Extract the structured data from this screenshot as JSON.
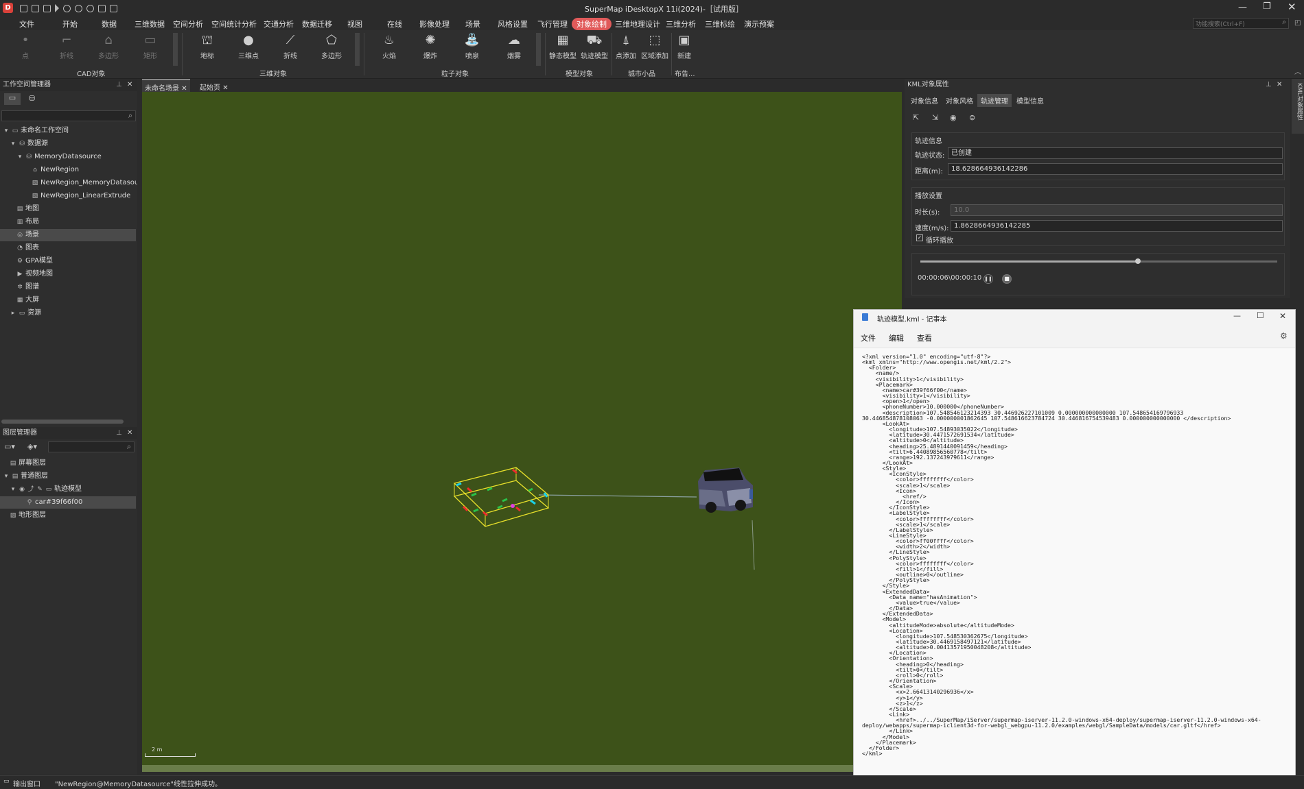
{
  "app": {
    "title": "SuperMap iDesktopX 11i(2024)-［试用版］",
    "search_placeholder": "功能搜索(Ctrl+F)"
  },
  "menu": [
    "文件",
    "开始",
    "数据",
    "三维数据",
    "空间分析",
    "空间统计分析",
    "交通分析",
    "数据迁移",
    "视图",
    "在线",
    "影像处理",
    "场景",
    "风格设置",
    "飞行管理",
    "对象绘制",
    "三维地理设计",
    "三维分析",
    "三维标绘",
    "演示预案"
  ],
  "ribbon": {
    "cad": [
      "点",
      "折线",
      "多边形",
      "矩形"
    ],
    "cad_group": "CAD对象",
    "obj3d": [
      "地标",
      "三维点",
      "折线",
      "多边形"
    ],
    "obj3d_group": "三维对象",
    "particle": [
      "火焰",
      "爆炸",
      "喷泉",
      "烟雾"
    ],
    "particle_group": "粒子对象",
    "model": [
      "静态模型",
      "轨迹模型"
    ],
    "model_group": "模型对象",
    "city": [
      "点添加",
      "区域添加"
    ],
    "city_group": "城市小品",
    "layout": [
      "新建"
    ],
    "layout_group": "布告..."
  },
  "workspace": {
    "title": "工作空间管理器",
    "items": [
      "未命名工作空间",
      "数据源",
      "MemoryDatasource",
      "NewRegion",
      "NewRegion_MemoryDatasource",
      "NewRegion_LinearExtrude",
      "地图",
      "布局",
      "场景",
      "图表",
      "GPA模型",
      "视频地图",
      "图谱",
      "大屏",
      "资源"
    ]
  },
  "layers": {
    "title": "图层管理器",
    "items": [
      "屏幕图层",
      "普通图层",
      "轨迹模型",
      "car#39f66f00",
      "地形图层"
    ]
  },
  "tabs": [
    "未命名场景",
    "起始页"
  ],
  "scale_label": "2 m",
  "kml": {
    "title": "KML对象属性",
    "side_tab": "KML对象属性",
    "tabs": [
      "对象信息",
      "对象风格",
      "轨迹管理",
      "模型信息"
    ],
    "track_info": "轨迹信息",
    "status_label": "轨迹状态:",
    "status_value": "已创建",
    "dist_label": "距离(m):",
    "dist_value": "18.628664936142286",
    "play_settings": "播放设置",
    "duration_label": "时长(s):",
    "duration_value": "10.0",
    "speed_label": "速度(m/s):",
    "speed_value": "1.8628664936142285",
    "loop_label": "循环播放",
    "time_text": "00:00:06\\00:00:10",
    "progress": 0.61
  },
  "notepad": {
    "title": "轨迹模型.kml - 记事本",
    "menu": [
      "文件",
      "编辑",
      "查看"
    ],
    "content": "<?xml version=\"1.0\" encoding=\"utf-8\"?>\n<kml xmlns=\"http://www.opengis.net/kml/2.2\">\n  <Folder>\n    <name/>\n    <visibility>1</visibility>\n    <Placemark>\n      <name>car#39f66f00</name>\n      <visibility>1</visibility>\n      <open>1</open>\n      <phoneNumber>10.000000</phoneNumber>\n      <description>107.548546123214393 30.446926227101009 0.000000000000000 107.548654169796933\n30.446854878108063 -0.000000001862645 107.548616623784724 30.446816754539483 0.000000000000000 </description>\n      <LookAt>\n        <longitude>107.54893035022</longitude>\n        <latitude>30.4471572691534</latitude>\n        <altitude>0</altitude>\n        <heading>25.4891440091459</heading>\n        <tilt>6.44089856560778</tilt>\n        <range>192.137243979611</range>\n      </LookAt>\n      <Style>\n        <IconStyle>\n          <color>ffffffff</color>\n          <scale>1</scale>\n          <Icon>\n            <href/>\n          </Icon>\n        </IconStyle>\n        <LabelStyle>\n          <color>ffffffff</color>\n          <scale>1</scale>\n        </LabelStyle>\n        <LineStyle>\n          <color>ff00ffff</color>\n          <width>2</width>\n        </LineStyle>\n        <PolyStyle>\n          <color>ffffffff</color>\n          <fill>1</fill>\n          <outline>0</outline>\n        </PolyStyle>\n      </Style>\n      <ExtendedData>\n        <Data name=\"hasAnimation\">\n          <value>true</value>\n        </Data>\n      </ExtendedData>\n      <Model>\n        <altitudeMode>absolute</altitudeMode>\n        <Location>\n          <longitude>107.548530362675</longitude>\n          <latitude>30.4469158497121</latitude>\n          <altitude>0.00413571950048208</altitude>\n        </Location>\n        <Orientation>\n          <heading>0</heading>\n          <tilt>0</tilt>\n          <roll>0</roll>\n        </Orientation>\n        <Scale>\n          <x>2.66413140296936</x>\n          <y>1</y>\n          <z>1</z>\n        </Scale>\n        <Link>\n          <href>../../SuperMap/iServer/supermap-iserver-11.2.0-windows-x64-deploy/supermap-iserver-11.2.0-windows-x64-\ndeploy/webapps/supermap-iclient3d-for-webgl_webgpu-11.2.0/examples/webgl/SampleData/models/car.gltf</href>\n        </Link>\n      </Model>\n    </Placemark>\n  </Folder>\n</kml>"
  },
  "status": {
    "output": "输出窗口",
    "message": "\"NewRegion@MemoryDatasource\"线性拉伸成功。"
  }
}
